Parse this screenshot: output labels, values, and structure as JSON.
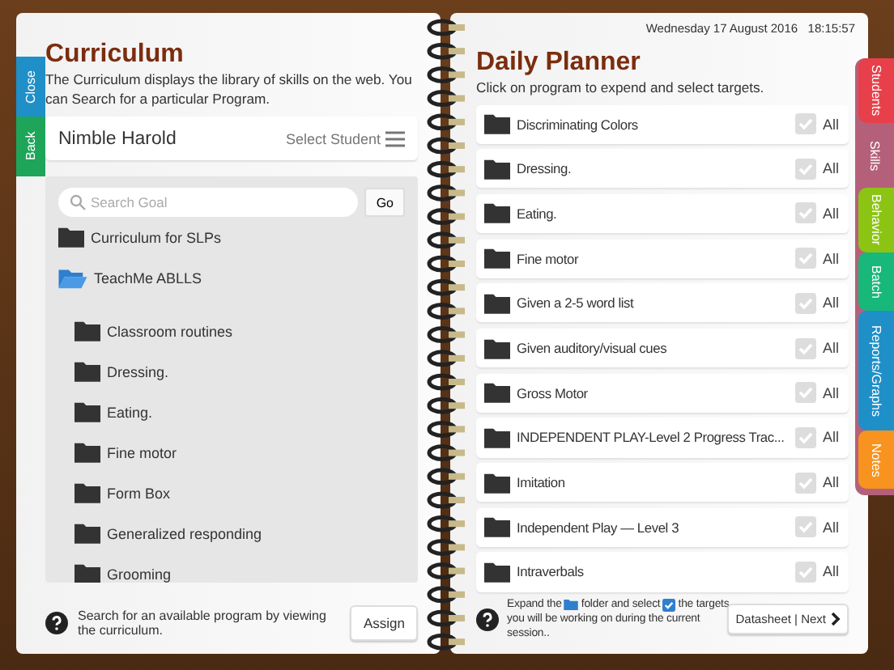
{
  "left_tabs": [
    {
      "label": "Close",
      "color": "#1f8fc8"
    },
    {
      "label": "Back",
      "color": "#1ea55a"
    }
  ],
  "curriculum": {
    "title": "Curriculum",
    "description": "The Curriculum displays the library of skills on the web. You can Search for a particular Program.",
    "student": "Nimble Harold",
    "select_student": "Select Student",
    "search": {
      "placeholder": "Search Goal",
      "button": "Go"
    },
    "tree": [
      {
        "label": "Curriculum for SLPs",
        "expanded": false
      },
      {
        "label": "TeachMe ABLLS",
        "expanded": true,
        "children": [
          {
            "label": "Classroom routines",
            "expanded": false
          },
          {
            "label": "Dressing.",
            "expanded": false
          },
          {
            "label": "Eating.",
            "expanded": false
          },
          {
            "label": "Fine motor",
            "expanded": false
          },
          {
            "label": "Form Box",
            "expanded": false
          },
          {
            "label": "Generalized responding",
            "expanded": false
          },
          {
            "label": "Grooming",
            "expanded": false
          }
        ]
      }
    ],
    "help": "Search for an available program by viewing the curriculum.",
    "assign_button": "Assign"
  },
  "planner": {
    "datetime": "Wednesday 17 August 2016   18:15:57",
    "title": "Daily Planner",
    "subtitle": "Click on program to expend and select targets.",
    "programs": [
      {
        "label": "Discriminating Colors",
        "checked": false,
        "all": "All"
      },
      {
        "label": "Dressing.",
        "checked": false,
        "all": "All"
      },
      {
        "label": "Eating.",
        "checked": false,
        "all": "All"
      },
      {
        "label": "Fine motor",
        "checked": false,
        "all": "All"
      },
      {
        "label": "Given a 2-5 word list",
        "checked": false,
        "all": "All"
      },
      {
        "label": "Given auditory/visual cues",
        "checked": false,
        "all": "All"
      },
      {
        "label": "Gross Motor",
        "checked": false,
        "all": "All"
      },
      {
        "label": "INDEPENDENT PLAY-Level 2 Progress Trac...",
        "checked": false,
        "all": "All"
      },
      {
        "label": "Imitation",
        "checked": false,
        "all": "All"
      },
      {
        "label": "Independent Play — Level 3",
        "checked": false,
        "all": "All"
      },
      {
        "label": "Intraverbals",
        "checked": false,
        "all": "All"
      }
    ],
    "help": [
      "Expand the",
      "folder and select",
      "the targets",
      "you will be working on during the current",
      "session.."
    ],
    "next_button": "Datasheet | Next"
  },
  "right_tabs": [
    {
      "label": "Students",
      "color": "#e8404a",
      "selected": false
    },
    {
      "label": "Skills",
      "color": "#b5607a",
      "selected": true
    },
    {
      "label": "Behavior",
      "color": "#8cc414",
      "selected": false
    },
    {
      "label": "Batch",
      "color": "#17b87a",
      "selected": false
    },
    {
      "label": "Reports/Graphs",
      "color": "#1f8fc8",
      "selected": false
    },
    {
      "label": "Notes",
      "color": "#f7931e",
      "selected": false
    }
  ]
}
